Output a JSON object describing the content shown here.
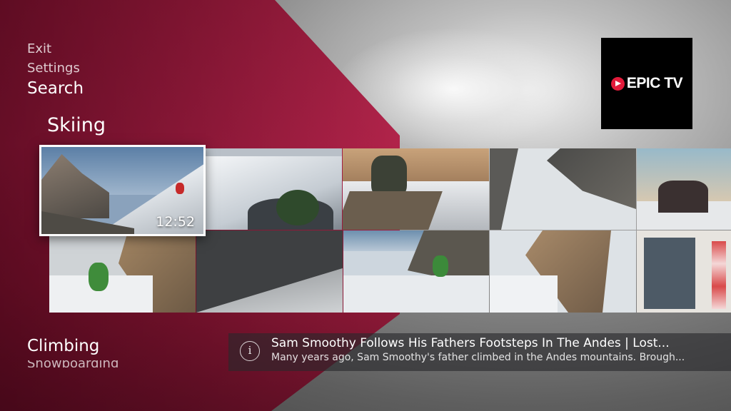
{
  "menu": {
    "exit": "Exit",
    "settings": "Settings",
    "search": "Search"
  },
  "rows": {
    "current_title": "Skiing",
    "next_title": "Climbing",
    "peek_title": "Snowboarding"
  },
  "selected_video": {
    "duration": "12:52",
    "title": "Sam Smoothy Follows His Fathers Footsteps In The Andes | Lost...",
    "description": "Many years ago, Sam Smoothy's father climbed in the Andes mountains. Brough..."
  },
  "icons": {
    "info": "info-icon",
    "brand": "epic-tv-logo"
  },
  "logo": {
    "text": "EPIC TV"
  },
  "colors": {
    "brand_red": "#e31b3b",
    "hero_overlay": "#b81a45"
  }
}
